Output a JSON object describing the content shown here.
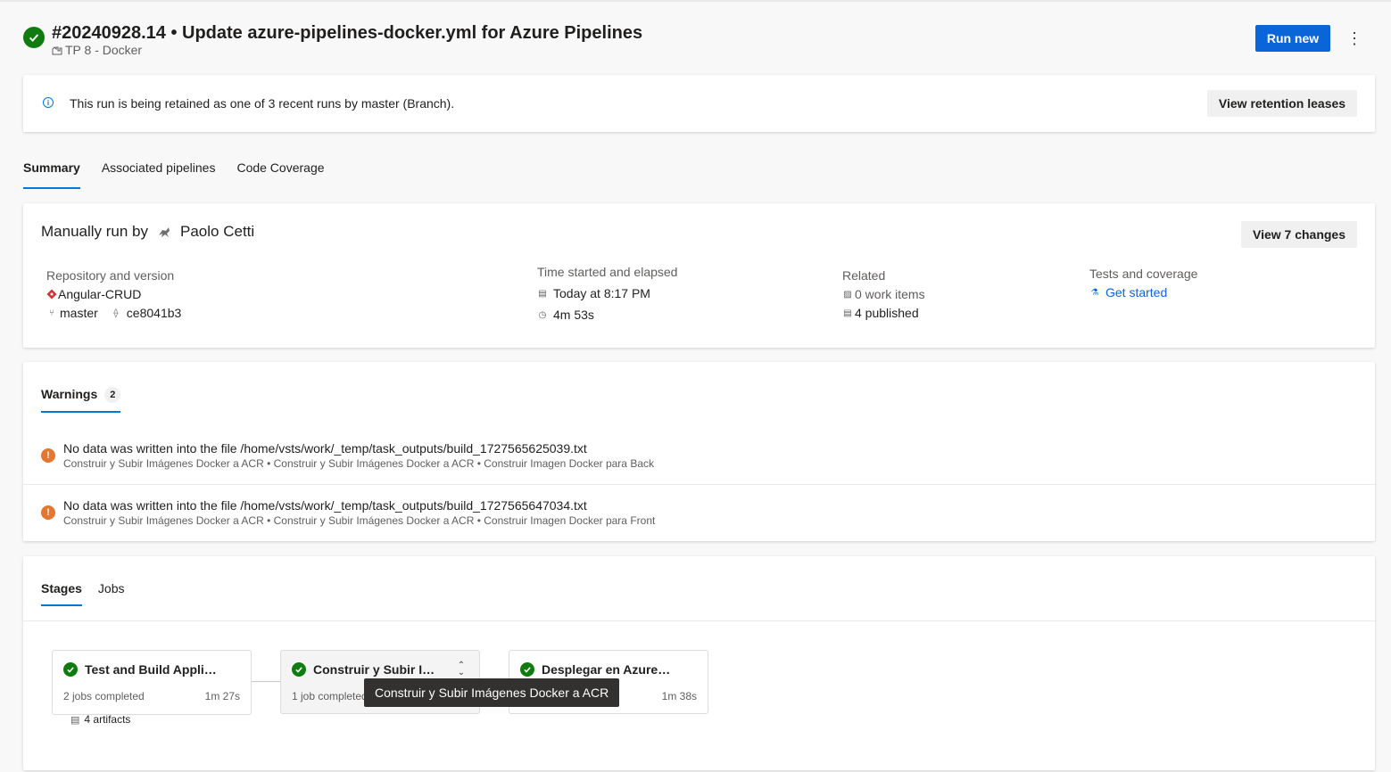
{
  "header": {
    "run_title": "#20240928.14 • Update azure-pipelines-docker.yml for Azure Pipelines",
    "pipeline_name": "TP 8 - Docker",
    "run_new_label": "Run new",
    "more_label": "⋮"
  },
  "banner": {
    "info_icon": "ⓘ",
    "message": "This run is being retained as one of 3 recent runs by master (Branch).",
    "button_label": "View retention leases"
  },
  "tabs": [
    {
      "label": "Summary",
      "active": true
    },
    {
      "label": "Associated pipelines",
      "active": false
    },
    {
      "label": "Code Coverage",
      "active": false
    }
  ],
  "summary": {
    "manual_run_prefix": "Manually run by",
    "user_name": "Paolo Cetti",
    "view_changes_label": "View 7 changes",
    "repository": {
      "label": "Repository and version",
      "name": "Angular-CRUD",
      "branch": "master",
      "commit": "ce8041b3"
    },
    "time": {
      "label": "Time started and elapsed",
      "started": "Today at 8:17 PM",
      "elapsed": "4m 53s"
    },
    "related": {
      "label": "Related",
      "work_items": "0 work items",
      "published": "4 published"
    },
    "tests": {
      "label": "Tests and coverage",
      "link": "Get started"
    }
  },
  "warnings": {
    "tab_label": "Warnings",
    "count": "2",
    "items": [
      {
        "message": "No data was written into the file /home/vsts/work/_temp/task_outputs/build_1727565625039.txt",
        "path": "Construir y Subir Imágenes Docker a ACR • Construir y Subir Imágenes Docker a ACR • Construir Imagen Docker para Back"
      },
      {
        "message": "No data was written into the file /home/vsts/work/_temp/task_outputs/build_1727565647034.txt",
        "path": "Construir y Subir Imágenes Docker a ACR • Construir y Subir Imágenes Docker a ACR • Construir Imagen Docker para Front"
      }
    ]
  },
  "stages": {
    "tabs": [
      {
        "label": "Stages",
        "active": true
      },
      {
        "label": "Jobs",
        "active": false
      }
    ],
    "items": [
      {
        "name": "Test and Build Appli…",
        "jobs": "2 jobs completed",
        "duration": "1m 27s",
        "artifacts": "4 artifacts"
      },
      {
        "name": "Construir y Subir I…",
        "jobs": "1 job completed",
        "duration": ""
      },
      {
        "name": "Desplegar en Azure…",
        "jobs": "",
        "duration": "1m 38s"
      }
    ],
    "tooltip": "Construir y Subir Imágenes Docker a ACR"
  },
  "colors": {
    "accent": "#0a66d8",
    "success": "#107c10",
    "warning": "#e47633"
  }
}
